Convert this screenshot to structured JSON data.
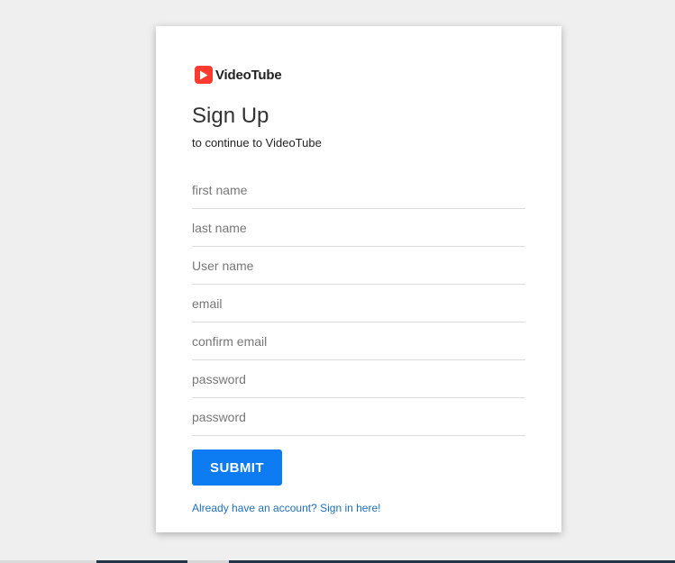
{
  "brand": {
    "name": "VideoTube",
    "icon": "play-icon",
    "icon_color": "#ff3b30"
  },
  "page": {
    "title": "Sign Up",
    "subtitle": "to continue to VideoTube"
  },
  "form": {
    "fields": [
      {
        "name": "first-name",
        "placeholder": "first name",
        "value": ""
      },
      {
        "name": "last-name",
        "placeholder": "last name",
        "value": ""
      },
      {
        "name": "username",
        "placeholder": "User name",
        "value": ""
      },
      {
        "name": "email",
        "placeholder": "email",
        "value": ""
      },
      {
        "name": "confirm-email",
        "placeholder": "confirm email",
        "value": ""
      },
      {
        "name": "password",
        "placeholder": "password",
        "value": ""
      },
      {
        "name": "confirm-password",
        "placeholder": "password",
        "value": ""
      }
    ],
    "submit_label": "SUBMIT"
  },
  "signin": {
    "label": "Already have an account? Sign in here!"
  },
  "colors": {
    "background": "#efefef",
    "card": "#ffffff",
    "accent": "#0d7bf2",
    "link": "#1f6fb8"
  }
}
